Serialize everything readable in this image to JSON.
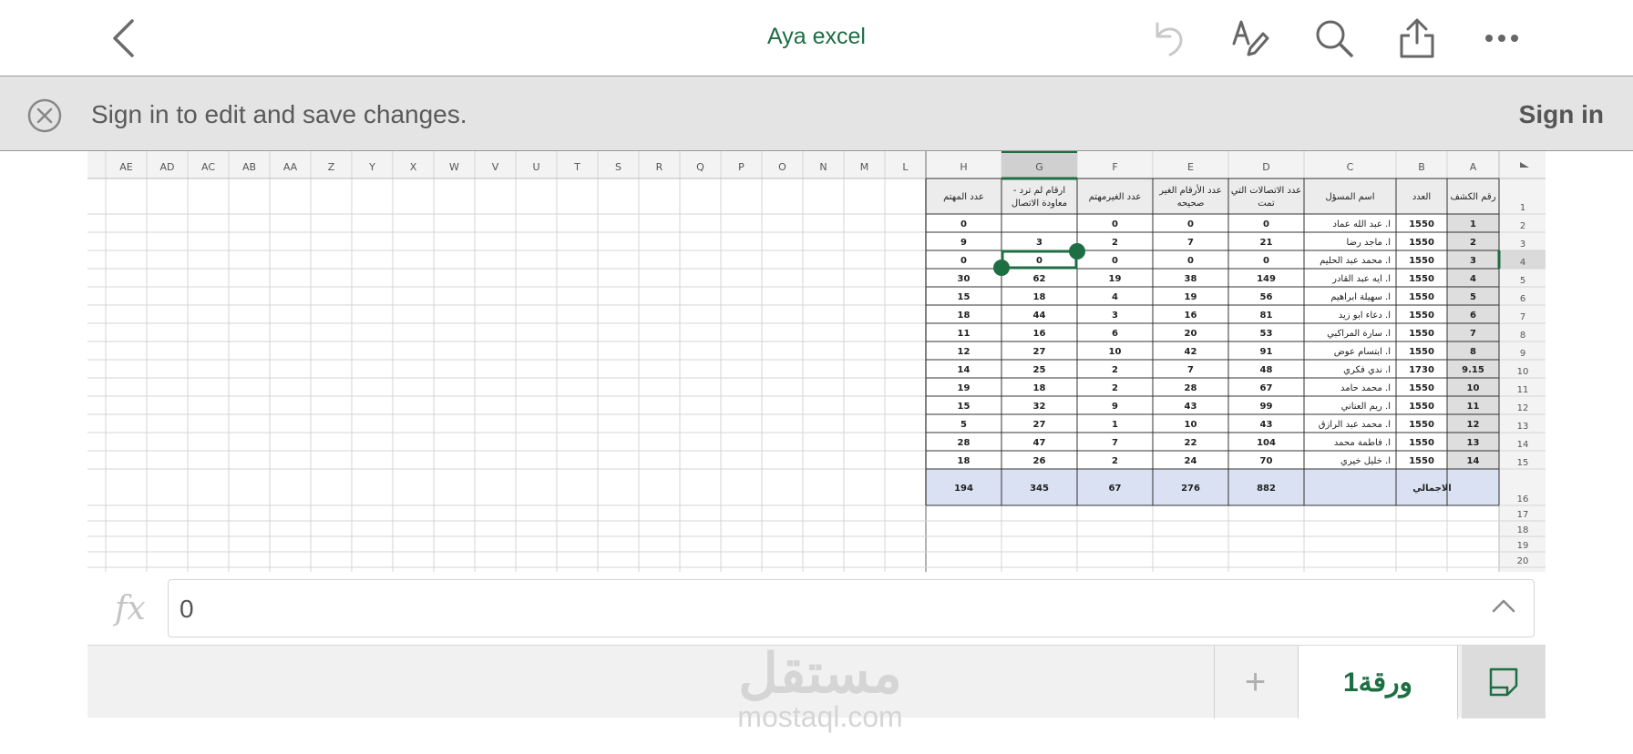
{
  "app": {
    "title": "Aya excel"
  },
  "banner": {
    "message": "Sign in to edit and save changes.",
    "sign_in": "Sign in"
  },
  "formula_bar": {
    "fx_label": "fx",
    "value": "0"
  },
  "tabs": {
    "add_label": "+",
    "sheet_name": "ورقة1"
  },
  "watermark": {
    "arabic": "مستقل",
    "latin": "mostaql.com"
  },
  "sheet": {
    "column_letters": [
      "A",
      "B",
      "C",
      "D",
      "E",
      "F",
      "G",
      "H",
      "L",
      "M",
      "N",
      "O",
      "P",
      "Q",
      "R",
      "S",
      "T",
      "U",
      "V",
      "W",
      "X",
      "Y",
      "Z",
      "AA",
      "AB",
      "AC",
      "AD",
      "AE"
    ],
    "row_numbers": [
      "1",
      "2",
      "3",
      "4",
      "5",
      "6",
      "7",
      "8",
      "9",
      "10",
      "11",
      "12",
      "13",
      "14",
      "15",
      "16",
      "17",
      "18",
      "19",
      "20"
    ],
    "headers": [
      "رقم الكشف",
      "العدد",
      "اسم المسؤل",
      "عدد الاتصالات التي تمت",
      "عدد الأرقام الغير صحيحه",
      "عدد الغيرمهتم",
      "ارقام لم ترد - معاودة الاتصال",
      "عدد المهتم"
    ],
    "rows": [
      [
        "1",
        "1550",
        "ا. عبد الله عماد",
        "0",
        "0",
        "0",
        "",
        "0"
      ],
      [
        "2",
        "1550",
        "ا. ماجد رضا",
        "21",
        "7",
        "2",
        "3",
        "9"
      ],
      [
        "3",
        "1550",
        "ا. محمد عبد الحليم",
        "0",
        "0",
        "0",
        "0",
        "0"
      ],
      [
        "4",
        "1550",
        "ا. ايه عبد القادر",
        "149",
        "38",
        "19",
        "62",
        "30"
      ],
      [
        "5",
        "1550",
        "ا. سهيلة ابراهيم",
        "56",
        "19",
        "4",
        "18",
        "15"
      ],
      [
        "6",
        "1550",
        "ا. دعاء ابو زيد",
        "81",
        "16",
        "3",
        "44",
        "18"
      ],
      [
        "7",
        "1550",
        "ا. سارة المراكبي",
        "53",
        "20",
        "6",
        "16",
        "11"
      ],
      [
        "8",
        "1550",
        "ا. ابتسام عوض",
        "91",
        "42",
        "10",
        "27",
        "12"
      ],
      [
        "9.15",
        "1730",
        "ا. ندي فكري",
        "48",
        "7",
        "2",
        "25",
        "14"
      ],
      [
        "10",
        "1550",
        "ا. محمد حامد",
        "67",
        "28",
        "2",
        "18",
        "19"
      ],
      [
        "11",
        "1550",
        "ا. ريم العناني",
        "99",
        "43",
        "9",
        "32",
        "15"
      ],
      [
        "12",
        "1550",
        "ا. محمد عبد الرازق",
        "43",
        "10",
        "1",
        "27",
        "5"
      ],
      [
        "13",
        "1550",
        "ا. فاطمة محمد",
        "104",
        "22",
        "7",
        "47",
        "28"
      ],
      [
        "14",
        "1550",
        "ا. خليل خيري",
        "70",
        "24",
        "2",
        "26",
        "18"
      ]
    ],
    "total": {
      "label": "الاجمالي",
      "D": "882",
      "E": "276",
      "F": "67",
      "G": "345",
      "H": "194"
    }
  }
}
